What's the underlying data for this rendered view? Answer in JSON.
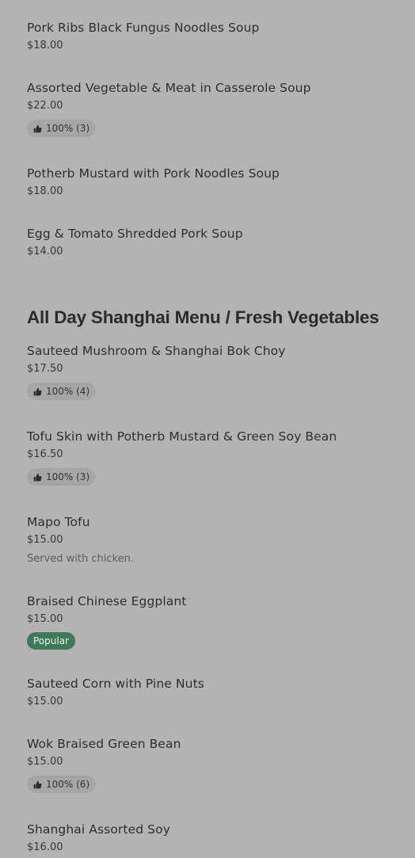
{
  "items_top": [
    {
      "name": "Pork Ribs Black Fungus Noodles Soup",
      "price": "$18.00"
    },
    {
      "name": "Assorted Vegetable & Meat in Casserole Soup",
      "price": "$22.00",
      "rating": "100% (3)"
    },
    {
      "name": "Potherb Mustard with Pork Noodles Soup",
      "price": "$18.00"
    },
    {
      "name": "Egg & Tomato Shredded Pork Soup",
      "price": "$14.00"
    }
  ],
  "section": {
    "title": "All Day Shanghai Menu / Fresh Vegetables"
  },
  "items_vegetables": [
    {
      "name": "Sauteed Mushroom & Shanghai Bok Choy",
      "price": "$17.50",
      "rating": "100% (4)"
    },
    {
      "name": "Tofu Skin with Potherb Mustard & Green Soy Bean",
      "price": "$16.50",
      "rating": "100% (3)"
    },
    {
      "name": "Mapo Tofu",
      "price": "$15.00",
      "description": "Served with chicken."
    },
    {
      "name": "Braised Chinese Eggplant",
      "price": "$15.00",
      "badge": "Popular"
    },
    {
      "name": "Sauteed Corn with Pine Nuts",
      "price": "$15.00"
    },
    {
      "name": "Wok Braised Green Bean",
      "price": "$15.00",
      "rating": "100% (6)"
    },
    {
      "name": "Shanghai Assorted Soy",
      "price": "$16.00"
    }
  ],
  "colors": {
    "background": "#b3b3b3",
    "rating_pill": "#a6a6a6",
    "popular_badge": "#3e7a5a"
  },
  "icons": {
    "rating": "thumbs-up-icon"
  }
}
